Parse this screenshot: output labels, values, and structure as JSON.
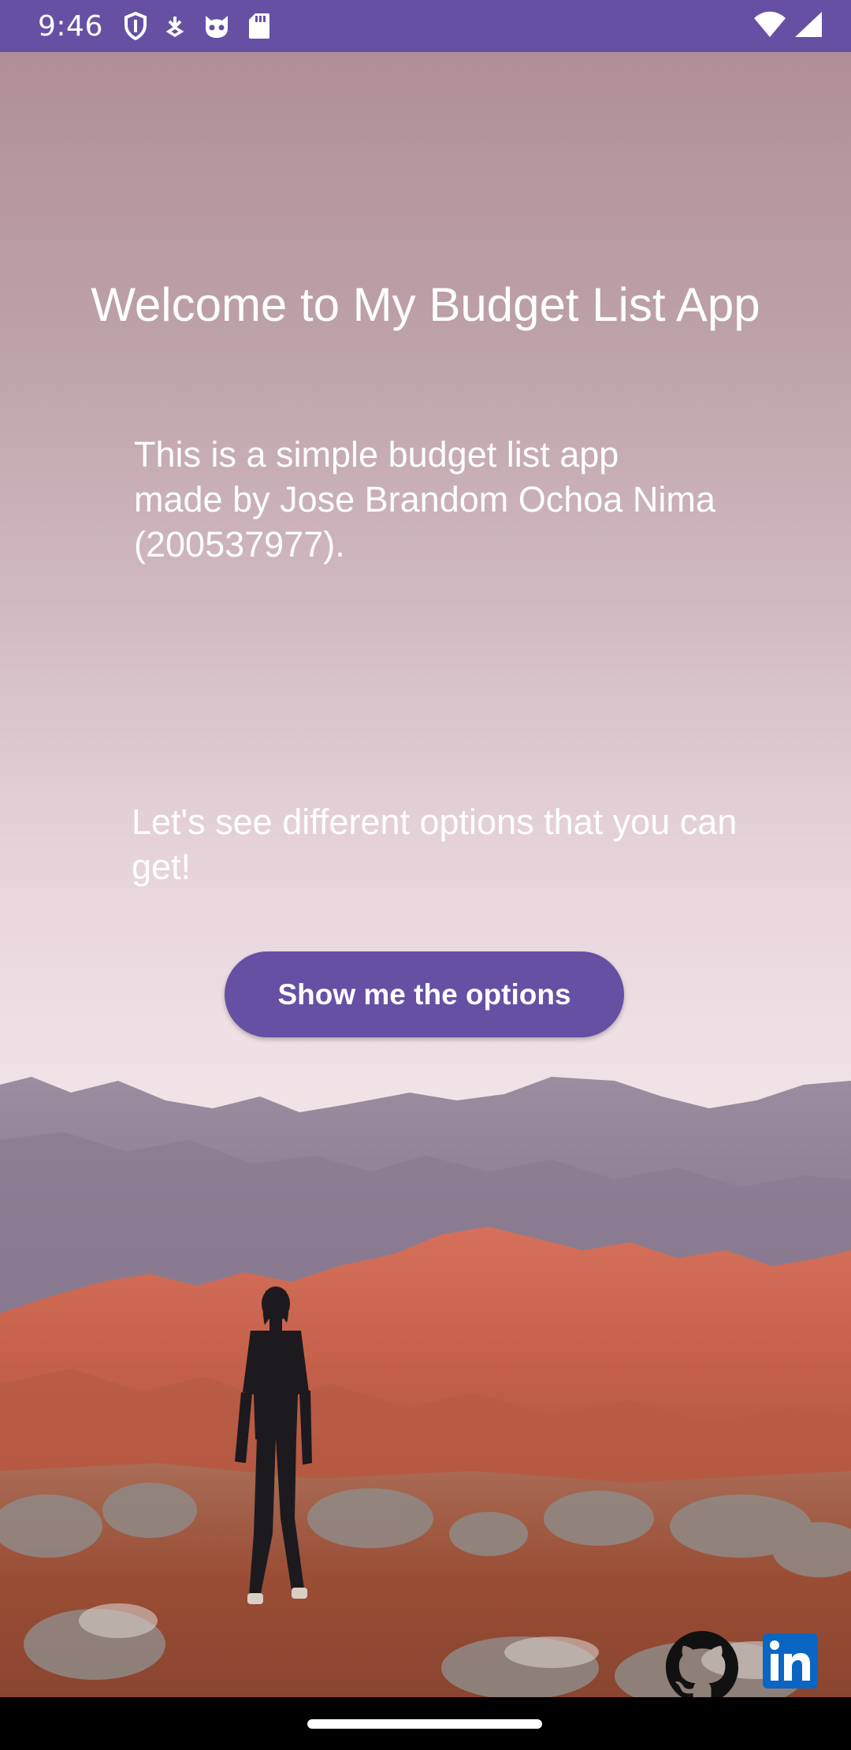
{
  "status_bar": {
    "time": "9:46",
    "left_icons": [
      "shield-icon",
      "download-status-icon",
      "cat-face-icon",
      "sd-card-icon"
    ],
    "right_icons": [
      "wifi-icon",
      "cellular-signal-icon"
    ],
    "background_color": "#6650a4"
  },
  "main": {
    "title": "Welcome to My Budget List App",
    "description": "This is a simple budget list app made by Jose Brandom Ochoa Nima (200537977).",
    "options_prompt": "Let's see different options that you can get!",
    "options_button_label": "Show me the options",
    "button_color": "#6650a4"
  },
  "footer_links": {
    "icons": [
      "github-icon",
      "linkedin-icon"
    ],
    "linkedin_color": "#0a66c2"
  }
}
